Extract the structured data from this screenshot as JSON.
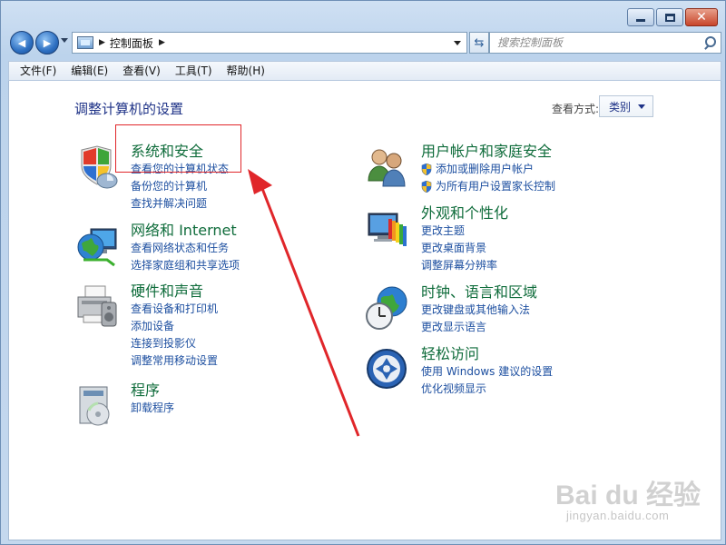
{
  "window": {
    "caption": {
      "minimize": "",
      "maximize": "",
      "close": "✕"
    }
  },
  "nav": {
    "back_glyph": "◀",
    "forward_glyph": "▶",
    "address": {
      "root_sep": "▶",
      "path": "控制面板",
      "path_sep": "▶"
    },
    "refresh_glyph": "⇆",
    "search": {
      "placeholder": "搜索控制面板"
    }
  },
  "menubar": {
    "items": [
      "文件(F)",
      "编辑(E)",
      "查看(V)",
      "工具(T)",
      "帮助(H)"
    ]
  },
  "main": {
    "title": "调整计算机的设置",
    "view_by": {
      "label": "查看方式:",
      "value": "类别"
    },
    "left_categories": [
      {
        "title": "系统和安全",
        "icon": "shield-icon",
        "links": [
          "查看您的计算机状态",
          "备份您的计算机",
          "查找并解决问题"
        ]
      },
      {
        "title": "网络和 Internet",
        "icon": "globe-network-icon",
        "links": [
          "查看网络状态和任务",
          "选择家庭组和共享选项"
        ]
      },
      {
        "title": "硬件和声音",
        "icon": "printer-icon",
        "links": [
          "查看设备和打印机",
          "添加设备",
          "连接到投影仪",
          "调整常用移动设置"
        ]
      },
      {
        "title": "程序",
        "icon": "programs-icon",
        "links": [
          "卸载程序"
        ]
      }
    ],
    "right_categories": [
      {
        "title": "用户帐户和家庭安全",
        "icon": "users-icon",
        "links": [
          "添加或删除用户帐户",
          "为所有用户设置家长控制"
        ],
        "shielded_links": true
      },
      {
        "title": "外观和个性化",
        "icon": "monitor-palette-icon",
        "links": [
          "更改主题",
          "更改桌面背景",
          "调整屏幕分辨率"
        ]
      },
      {
        "title": "时钟、语言和区域",
        "icon": "clock-globe-icon",
        "links": [
          "更改键盘或其他输入法",
          "更改显示语言"
        ]
      },
      {
        "title": "轻松访问",
        "icon": "ease-of-access-icon",
        "links": [
          "使用 Windows 建议的设置",
          "优化视频显示"
        ]
      }
    ]
  },
  "watermark": {
    "logo": "Bai du 经验",
    "url": "jingyan.baidu.com"
  },
  "colors": {
    "category_title": "#0f6c3b",
    "link": "#1d4fa0",
    "annotation": "#e0262a"
  }
}
